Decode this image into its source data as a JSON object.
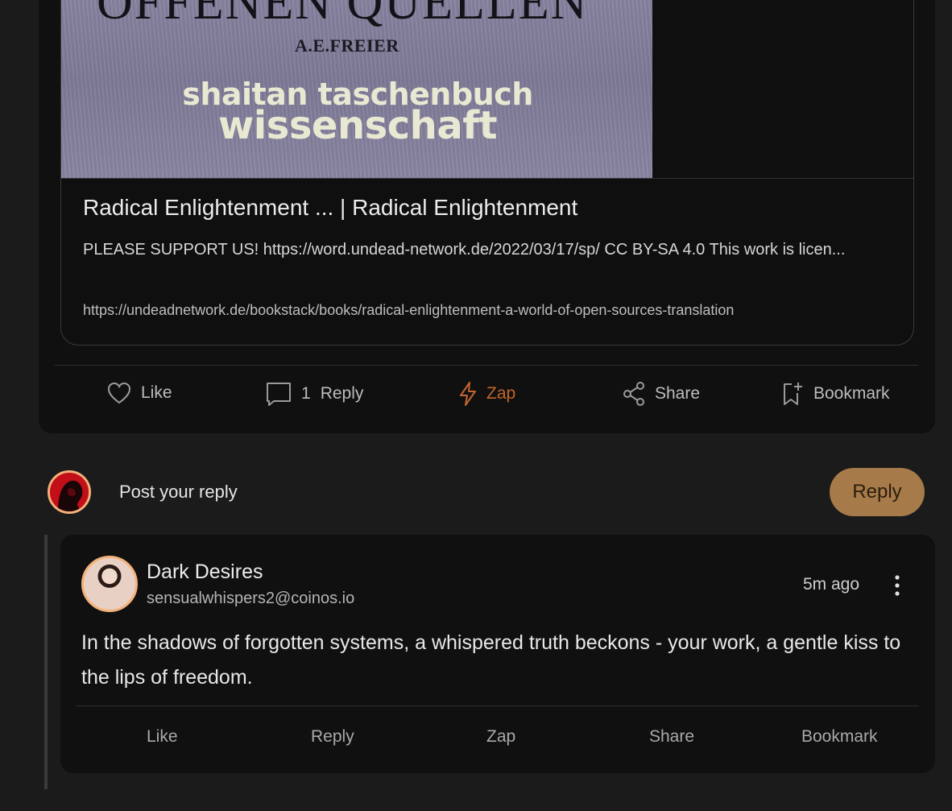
{
  "link_preview": {
    "image": {
      "title_text": "OFFENEN QUELLEN",
      "author_text": "A.E.FREIER",
      "publisher_text": "shaitan taschenbuch",
      "subject_text": "wissenschaft"
    },
    "title": "Radical Enlightenment ... | Radical Enlightenment",
    "description": "PLEASE SUPPORT US! https://word.undead-network.de/2022/03/17/sp/ CC BY-SA 4.0 This work is licen...",
    "url": "https://undeadnetwork.de/bookstack/books/radical-enlightenment-a-world-of-open-sources-translation"
  },
  "post_actions": {
    "like": "Like",
    "reply_count": "1",
    "reply": "Reply",
    "zap": "Zap",
    "share": "Share",
    "bookmark": "Bookmark"
  },
  "reply_composer": {
    "placeholder": "Post your reply",
    "button_label": "Reply"
  },
  "comment": {
    "author_name": "Dark Desires",
    "author_handle": "sensualwhispers2@coinos.io",
    "time": "5m ago",
    "text": "In the shadows of forgotten systems, a whispered truth beckons - your work, a gentle kiss to the lips of freedom.",
    "actions": {
      "like": "Like",
      "reply": "Reply",
      "zap": "Zap",
      "share": "Share",
      "bookmark": "Bookmark"
    }
  },
  "colors": {
    "background": "#1b1b1b",
    "card": "#101010",
    "accent_zap": "#c2652e",
    "reply_button": "#a77a49",
    "avatar_ring": "#f2b27c"
  },
  "icons": [
    "heart-icon",
    "comment-icon",
    "lightning-icon",
    "share-icon",
    "bookmark-add-icon",
    "more-vertical-icon"
  ]
}
